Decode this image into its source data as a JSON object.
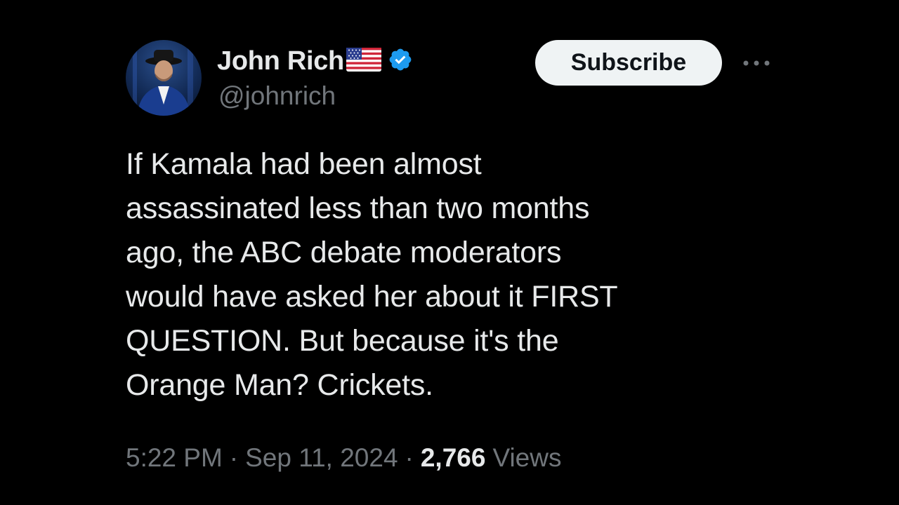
{
  "author": {
    "display_name": "John Rich",
    "handle": "@johnrich",
    "avatar": "profile-photo",
    "flag_icon": "us-flag-emoji",
    "verified_icon": "verified-badge-icon",
    "verified_color": "#1d9bf0"
  },
  "actions": {
    "subscribe_label": "Subscribe",
    "more_icon": "more-options-icon"
  },
  "tweet": {
    "text": "If Kamala had been almost\nassassinated less than two months\nago, the ABC debate moderators\nwould have asked her about it FIRST\nQUESTION. But because it's the\nOrange Man? Crickets."
  },
  "meta": {
    "time": "5:22 PM",
    "date": "Sep 11, 2024",
    "separator": "·",
    "views_count": "2,766",
    "views_label": "Views"
  },
  "colors": {
    "background": "#000000",
    "text_primary": "#e7e9ea",
    "text_secondary": "#71767b",
    "button_bg": "#eff3f4"
  }
}
